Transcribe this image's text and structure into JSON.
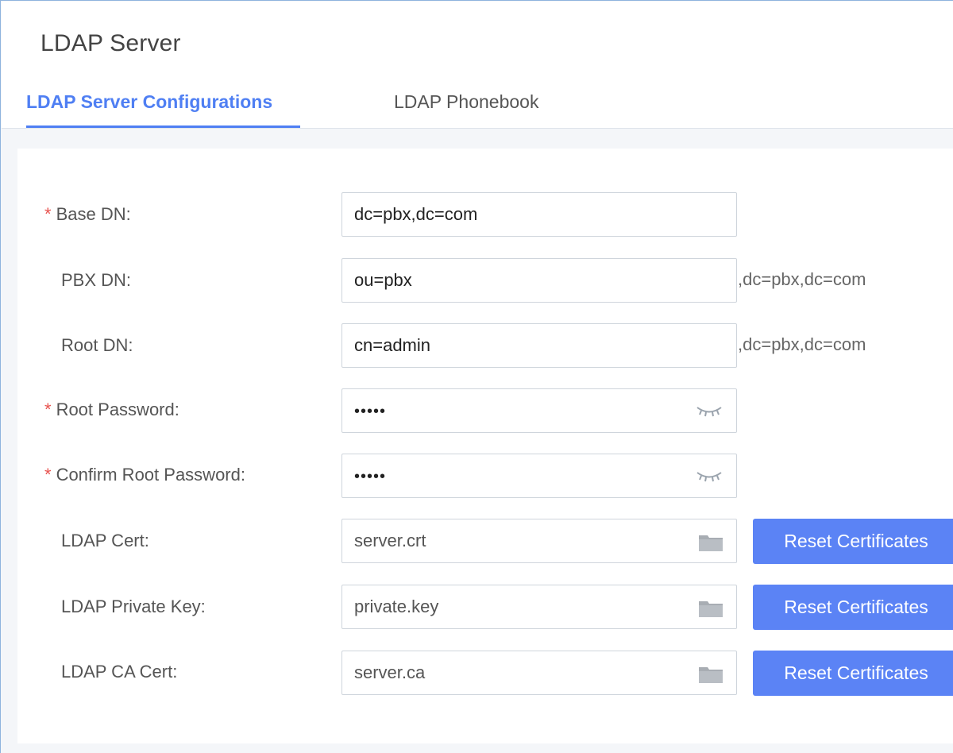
{
  "page": {
    "title": "LDAP Server"
  },
  "tabs": [
    {
      "label": "LDAP Server Configurations",
      "active": true
    },
    {
      "label": "LDAP Phonebook",
      "active": false
    }
  ],
  "form": {
    "required_marker": "*",
    "rows": [
      {
        "label": "Base DN:",
        "value": "dc=pbx,dc=com",
        "required": true
      },
      {
        "label": "PBX DN:",
        "value": "ou=pbx",
        "suffix": ",dc=pbx,dc=com",
        "required": false
      },
      {
        "label": "Root DN:",
        "value": "cn=admin",
        "suffix": ",dc=pbx,dc=com",
        "required": false
      },
      {
        "label": "Root Password:",
        "value": "•••••",
        "required": true,
        "icon": "eye-closed-icon"
      },
      {
        "label": "Confirm Root Password:",
        "value": "•••••",
        "required": true,
        "icon": "eye-closed-icon"
      },
      {
        "label": "LDAP Cert:",
        "value": "server.crt",
        "required": false,
        "icon": "folder-icon",
        "button": "Reset Certificates"
      },
      {
        "label": "LDAP Private Key:",
        "value": "private.key",
        "required": false,
        "icon": "folder-icon",
        "button": "Reset Certificates"
      },
      {
        "label": "LDAP CA Cert:",
        "value": "server.ca",
        "required": false,
        "icon": "folder-icon",
        "button": "Reset Certificates"
      }
    ]
  },
  "colors": {
    "accent": "#4f7ff3",
    "button_bg": "#5b83f5",
    "required": "#e8534f",
    "page_bg": "#f4f6f9"
  }
}
